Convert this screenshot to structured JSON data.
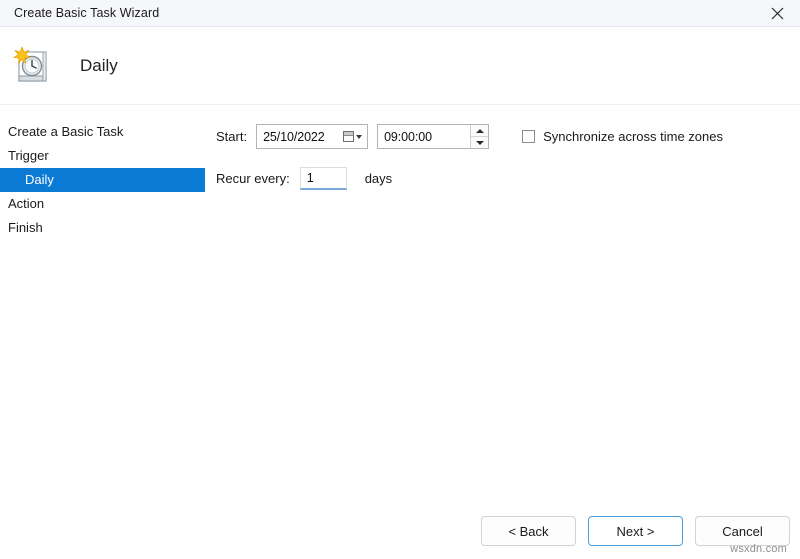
{
  "window": {
    "title": "Create Basic Task Wizard",
    "close_icon": "close-icon"
  },
  "header": {
    "icon": "calendar-clock-icon",
    "title": "Daily"
  },
  "sidebar": {
    "items": [
      {
        "label": "Create a Basic Task",
        "selected": false,
        "indented": false
      },
      {
        "label": "Trigger",
        "selected": false,
        "indented": false
      },
      {
        "label": "Daily",
        "selected": true,
        "indented": true
      },
      {
        "label": "Action",
        "selected": false,
        "indented": false
      },
      {
        "label": "Finish",
        "selected": false,
        "indented": false
      }
    ]
  },
  "form": {
    "start_label": "Start:",
    "start_date": "25/10/2022",
    "start_date_dropdown_icon": "calendar-icon",
    "start_time": "09:00:00",
    "spinner_up_icon": "arrow-up-icon",
    "spinner_down_icon": "arrow-down-icon",
    "sync_checkbox_label": "Synchronize across time zones",
    "sync_checkbox_checked": false,
    "recur_label": "Recur every:",
    "recur_value": "1",
    "recur_unit": "days"
  },
  "footer": {
    "back_label": "< Back",
    "next_label": "Next >",
    "cancel_label": "Cancel"
  },
  "watermark": {
    "text": "wsxdn.com"
  },
  "colors": {
    "accent_selection": "#0b7ad4",
    "default_button_border": "#4a9fd8",
    "titlebar_bg": "#f6f7fb",
    "focus_underline": "#7ba7d7"
  }
}
